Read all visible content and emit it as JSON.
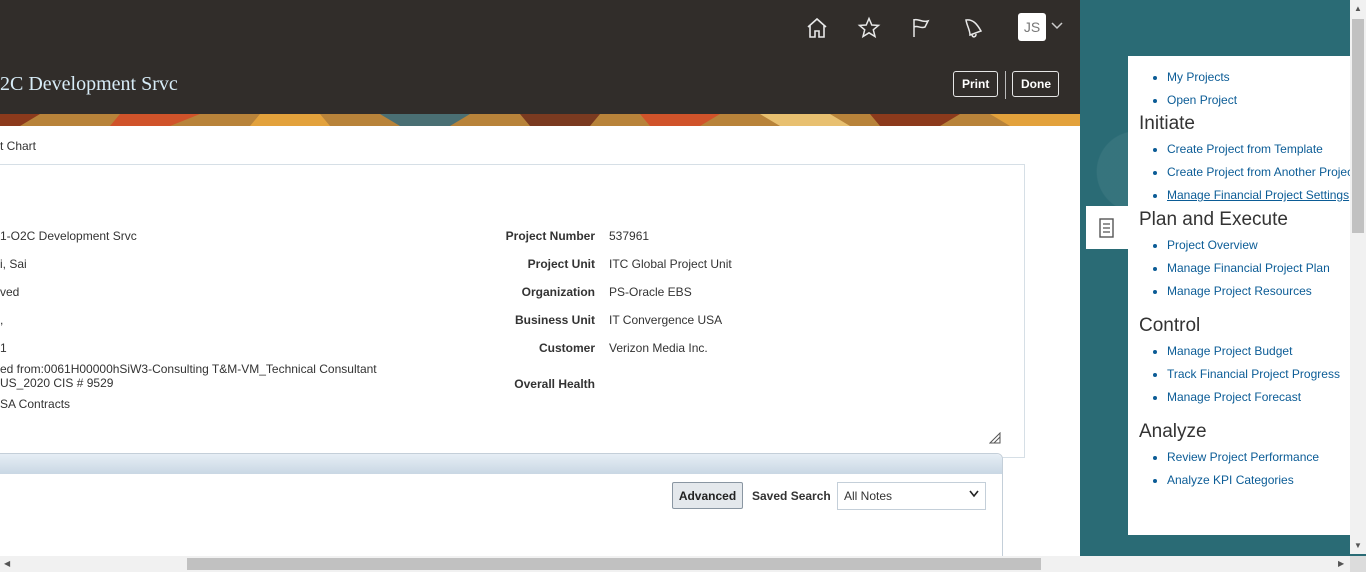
{
  "header": {
    "title": "2C Development Srvc",
    "avatar_initials": "JS",
    "print_label": "Print",
    "done_label": "Done",
    "icons": [
      "home-icon",
      "favorites-star-icon",
      "watchlist-flag-icon",
      "notifications-bell-icon"
    ]
  },
  "breadcrumb": {
    "label": "t Chart"
  },
  "details": {
    "left_values": [
      "1-O2C Development Srvc",
      "i, Sai",
      "ved",
      ",",
      "1",
      "ed from:0061H00000hSiW3-Consulting T&M-VM_Technical Consultant",
      "US_2020 CIS # 9529",
      "SA Contracts"
    ],
    "fields": [
      {
        "label": "Project Number",
        "value": "537961"
      },
      {
        "label": "Project Unit",
        "value": "ITC Global Project Unit"
      },
      {
        "label": "Organization",
        "value": "PS-Oracle EBS"
      },
      {
        "label": "Business Unit",
        "value": "IT Convergence USA"
      },
      {
        "label": "Customer",
        "value": "Verizon Media Inc."
      },
      {
        "label": "Overall Health",
        "value": ""
      }
    ]
  },
  "notes": {
    "advanced_label": "Advanced",
    "saved_search_label": "Saved Search",
    "saved_search_value": "All Notes"
  },
  "tasks": {
    "top_links": [
      "My Projects",
      "Open Project"
    ],
    "sections": [
      {
        "title": "Initiate",
        "links": [
          "Create Project from Template",
          "Create Project from Another Projec",
          "Manage Financial Project Settings"
        ]
      },
      {
        "title": "Plan and Execute",
        "links": [
          "Project Overview",
          "Manage Financial Project Plan",
          "Manage Project Resources"
        ]
      },
      {
        "title": "Control",
        "links": [
          "Manage Project Budget",
          "Track Financial Project Progress",
          "Manage Project Forecast"
        ]
      },
      {
        "title": "Analyze",
        "links": [
          "Review Project Performance",
          "Analyze KPI Categories"
        ]
      }
    ]
  },
  "colors": {
    "header_bg": "#312d2a",
    "link": "#0b5c96",
    "panel_bg": "#2a6b75"
  }
}
